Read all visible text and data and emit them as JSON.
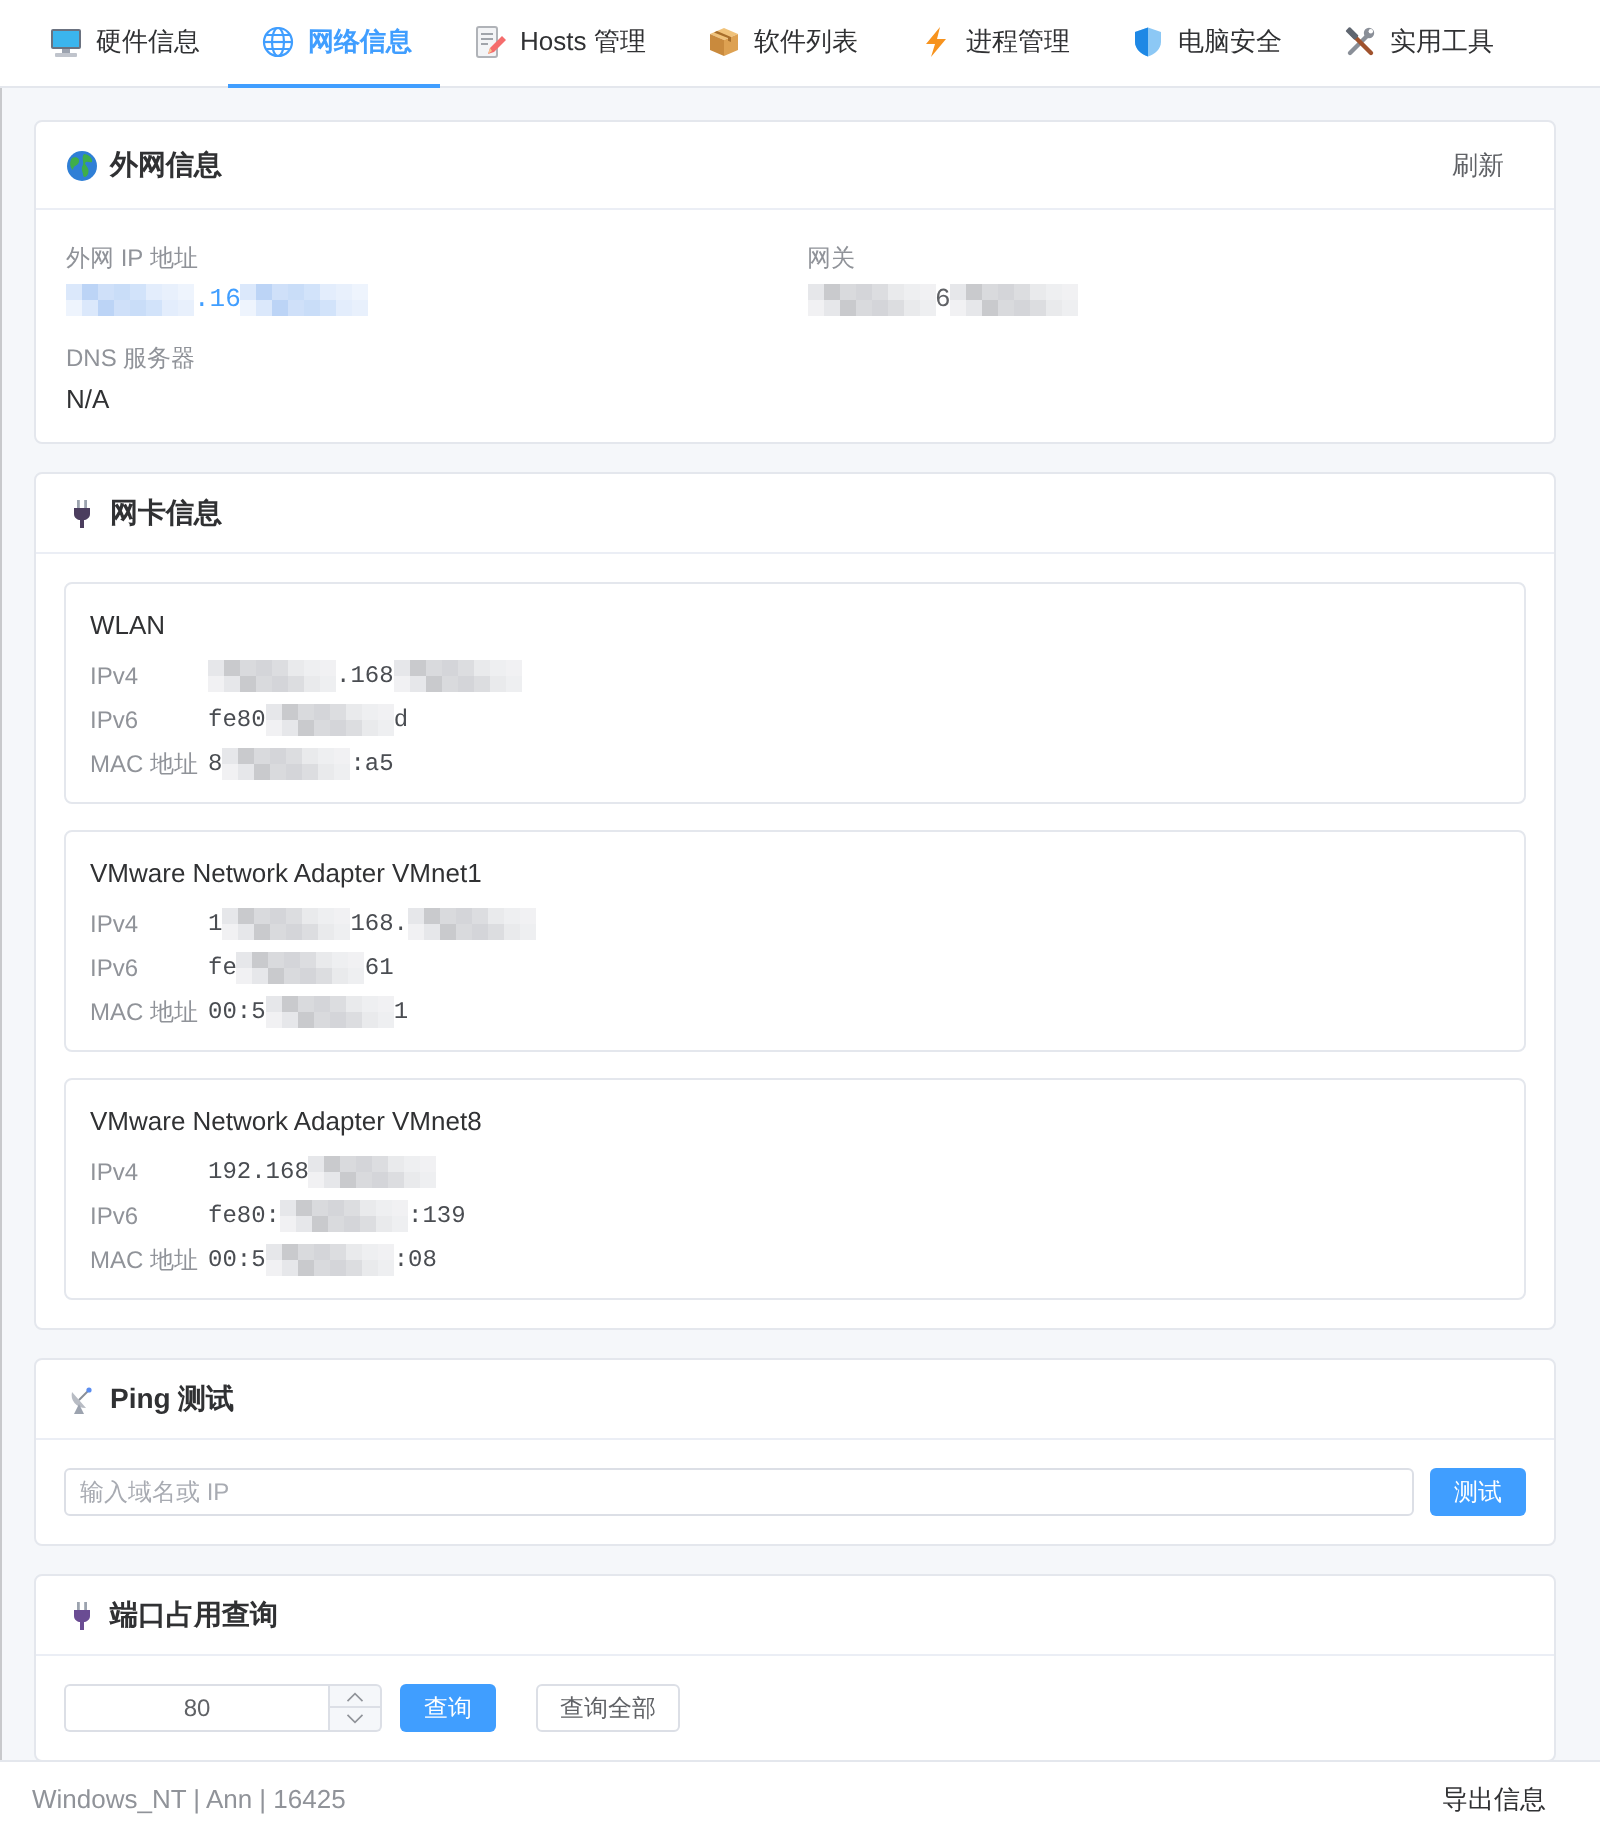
{
  "tabs": [
    {
      "label": "硬件信息",
      "selected": false
    },
    {
      "label": "网络信息",
      "selected": true
    },
    {
      "label": "Hosts 管理",
      "selected": false
    },
    {
      "label": "软件列表",
      "selected": false
    },
    {
      "label": "进程管理",
      "selected": false
    },
    {
      "label": "电脑安全",
      "selected": false
    },
    {
      "label": "实用工具",
      "selected": false
    }
  ],
  "external_network": {
    "title": "外网信息",
    "refresh_button": "刷新",
    "fields": [
      {
        "kind": "primary",
        "label": "外网 IP 地址",
        "value": [
          {
            "kind": "mosaic"
          },
          {
            "kind": "text",
            "text": ".16"
          },
          {
            "kind": "mosaic"
          }
        ]
      },
      {
        "kind": "mono",
        "label": "网关",
        "value": [
          {
            "kind": "mosaic"
          },
          {
            "kind": "text",
            "text": "6"
          },
          {
            "kind": "mosaic"
          }
        ]
      },
      {
        "kind": "plain",
        "label": "DNS 服务器",
        "value": [
          {
            "kind": "text",
            "text": "N/A"
          }
        ]
      }
    ]
  },
  "adapters": {
    "title": "网卡信息",
    "items": [
      {
        "name": "WLAN",
        "rows": [
          {
            "label": "IPv4",
            "value": [
              {
                "kind": "mosaic"
              },
              {
                "kind": "text",
                "text": ".168"
              },
              {
                "kind": "mosaic"
              }
            ]
          },
          {
            "label": "IPv6",
            "value": [
              {
                "kind": "text",
                "text": "fe80"
              },
              {
                "kind": "mosaic"
              },
              {
                "kind": "text",
                "text": "d"
              }
            ]
          },
          {
            "label": "MAC 地址",
            "value": [
              {
                "kind": "text",
                "text": "8"
              },
              {
                "kind": "mosaic"
              },
              {
                "kind": "text",
                "text": ":a5"
              }
            ]
          }
        ]
      },
      {
        "name": "VMware Network Adapter VMnet1",
        "rows": [
          {
            "label": "IPv4",
            "value": [
              {
                "kind": "text",
                "text": "1"
              },
              {
                "kind": "mosaic"
              },
              {
                "kind": "text",
                "text": "168."
              },
              {
                "kind": "mosaic"
              }
            ]
          },
          {
            "label": "IPv6",
            "value": [
              {
                "kind": "text",
                "text": "fe"
              },
              {
                "kind": "mosaic"
              },
              {
                "kind": "text",
                "text": "61"
              }
            ]
          },
          {
            "label": "MAC 地址",
            "value": [
              {
                "kind": "text",
                "text": "00:5"
              },
              {
                "kind": "mosaic"
              },
              {
                "kind": "text",
                "text": "1"
              }
            ]
          }
        ]
      },
      {
        "name": "VMware Network Adapter VMnet8",
        "rows": [
          {
            "label": "IPv4",
            "value": [
              {
                "kind": "text",
                "text": "192.168"
              },
              {
                "kind": "mosaic"
              }
            ]
          },
          {
            "label": "IPv6",
            "value": [
              {
                "kind": "text",
                "text": "fe80:"
              },
              {
                "kind": "mosaic"
              },
              {
                "kind": "text",
                "text": ":139"
              }
            ]
          },
          {
            "label": "MAC 地址",
            "value": [
              {
                "kind": "text",
                "text": "00:5"
              },
              {
                "kind": "mosaic"
              },
              {
                "kind": "text",
                "text": ":08"
              }
            ]
          }
        ]
      }
    ]
  },
  "ping": {
    "title": "Ping 测试",
    "placeholder": "输入域名或 IP",
    "test_button": "测试"
  },
  "port_query": {
    "title": "端口占用查询",
    "port": "80",
    "query_button": "查询",
    "query_all_button": "查询全部"
  },
  "status_bar": {
    "info": "Windows_NT | Ann | 16425",
    "export_button": "导出信息"
  }
}
